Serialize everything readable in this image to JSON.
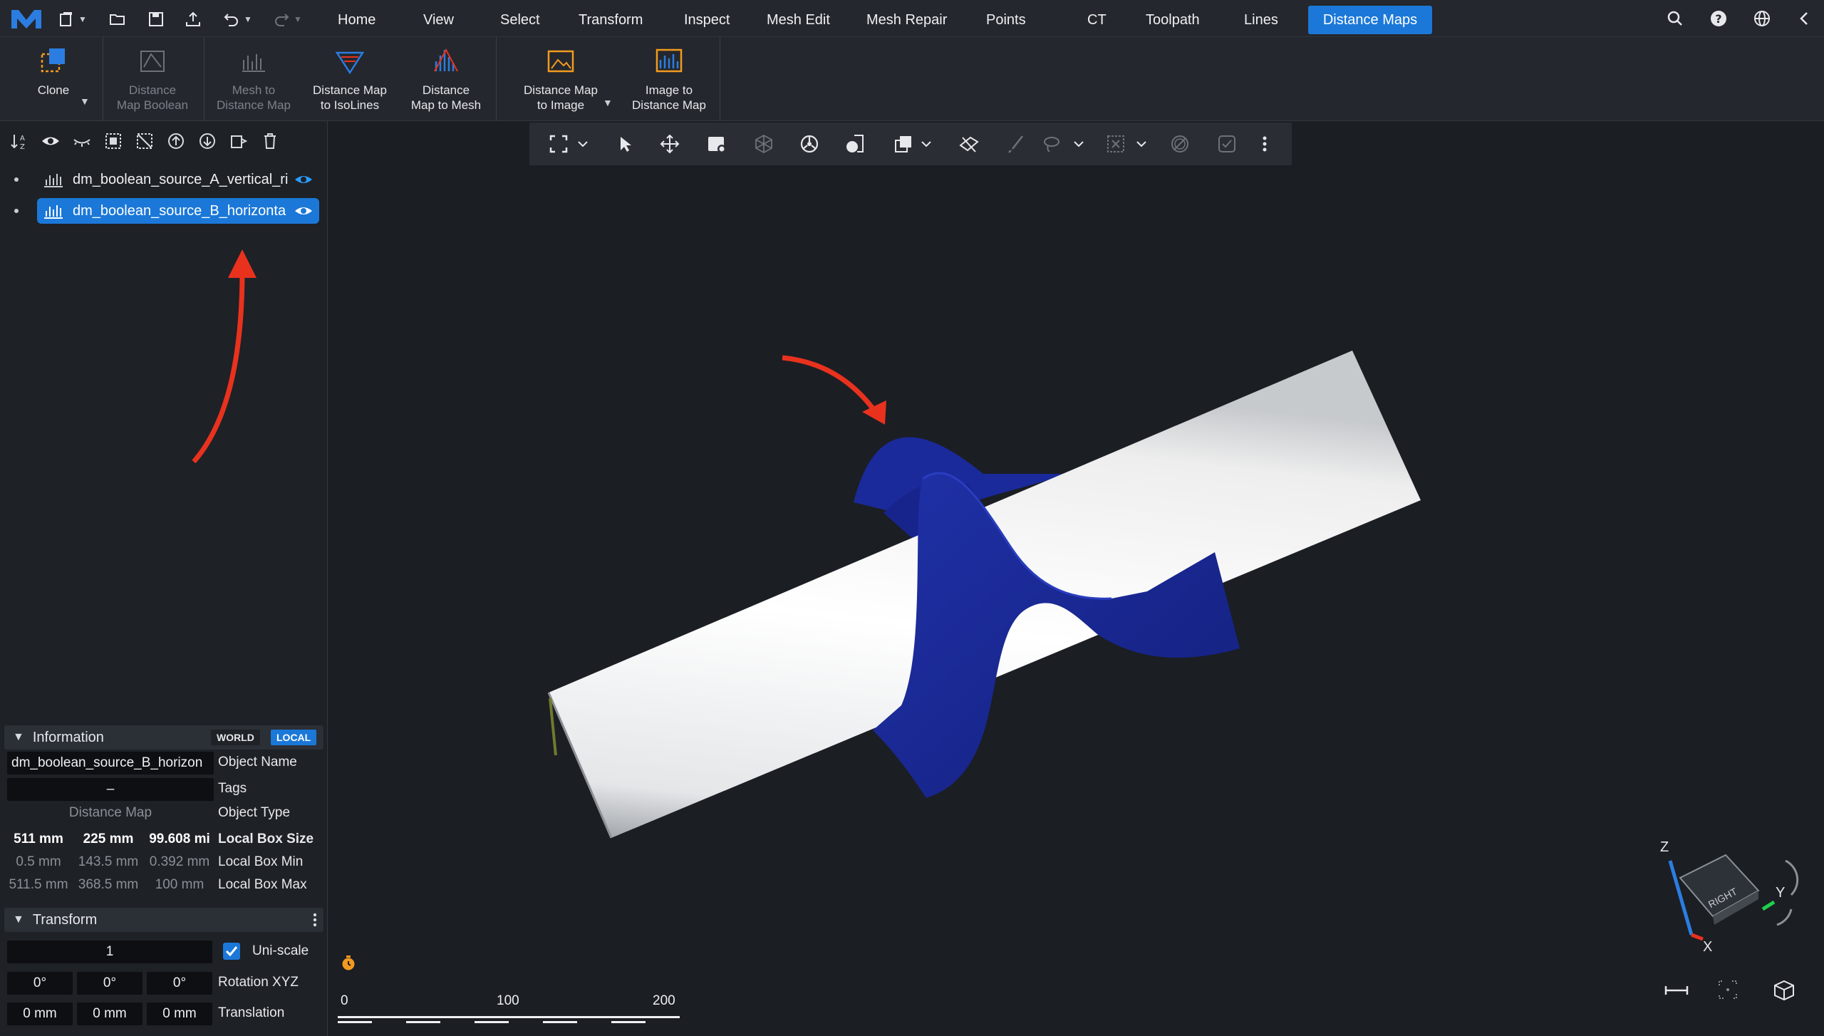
{
  "menu": {
    "items": [
      "Home",
      "View",
      "Select",
      "Transform",
      "Inspect",
      "Mesh Edit",
      "Mesh Repair",
      "Points",
      "CT",
      "Toolpath",
      "Lines",
      "Distance Maps"
    ],
    "active": "Distance Maps"
  },
  "ribbon": {
    "clone": "Clone",
    "dm_boolean": [
      "Distance",
      "Map Boolean"
    ],
    "mesh_to_dm": [
      "Mesh to",
      "Distance Map"
    ],
    "dm_to_isolines": [
      "Distance Map",
      "to IsoLines"
    ],
    "dm_to_mesh": [
      "Distance",
      "Map to Mesh"
    ],
    "dm_to_image": [
      "Distance Map",
      "to Image"
    ],
    "image_to_dm": [
      "Image to",
      "Distance Map"
    ]
  },
  "scene_tree": {
    "items": [
      {
        "name": "dm_boolean_source_A_vertical_ri"
      },
      {
        "name": "dm_boolean_source_B_horizonta"
      }
    ]
  },
  "information": {
    "title": "Information",
    "world": "WORLD",
    "local": "LOCAL",
    "object_name_value": "dm_boolean_source_B_horizon",
    "object_name_label": "Object Name",
    "tags_value": "–",
    "tags_label": "Tags",
    "object_type_value": "Distance Map",
    "object_type_label": "Object Type",
    "box_size": [
      "511 mm",
      "225 mm",
      "99.608 mi"
    ],
    "box_size_label": "Local Box Size",
    "box_min": [
      "0.5 mm",
      "143.5 mm",
      "0.392 mm"
    ],
    "box_min_label": "Local Box Min",
    "box_max": [
      "511.5 mm",
      "368.5 mm",
      "100 mm"
    ],
    "box_max_label": "Local Box Max"
  },
  "transform": {
    "title": "Transform",
    "scale_value": "1",
    "uniscale_label": "Uni-scale",
    "uniscale_checked": true,
    "rotation": [
      "0°",
      "0°",
      "0°"
    ],
    "rotation_label": "Rotation XYZ",
    "translation": [
      "0 mm",
      "0 mm",
      "0 mm"
    ],
    "translation_label": "Translation"
  },
  "viewport": {
    "scale_bar": [
      "0",
      "100",
      "200"
    ],
    "axes": {
      "z": "Z",
      "y": "Y",
      "x": "X",
      "face": "RIGHT"
    }
  },
  "colors": {
    "accent": "#1b78d8",
    "mesh_blue": "#1a2a9a",
    "annotation_red": "#e8321e",
    "icon_orange": "#f29a1f"
  }
}
